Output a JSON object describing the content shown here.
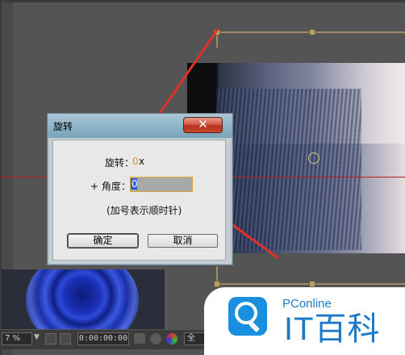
{
  "dialog": {
    "title": "旋转",
    "close_glyph": "✕",
    "rotation_label": "旋转：",
    "rotation_value": "0",
    "rotation_unit": "x",
    "angle_label": "+ 角度：",
    "angle_value": "0",
    "hint": "(加号表示顺时针)",
    "ok_label": "确定",
    "cancel_label": "取消"
  },
  "toolbar": {
    "zoom": "7 %",
    "zoom_dropdown": "▼",
    "timecode": "0:00:00:00",
    "resolution": "全"
  },
  "watermark": {
    "brand_small": "PConline",
    "brand_big": "IT百科"
  },
  "colors": {
    "guide_red": "#b3201e",
    "dialog_title_bg": "#8bb2c7",
    "close_button": "#c7482e",
    "watermark_blue": "#1a7ac8"
  },
  "icons": [
    "close-icon",
    "camera-icon",
    "people-icon",
    "color-wheel-icon",
    "search-magnifier-icon"
  ]
}
